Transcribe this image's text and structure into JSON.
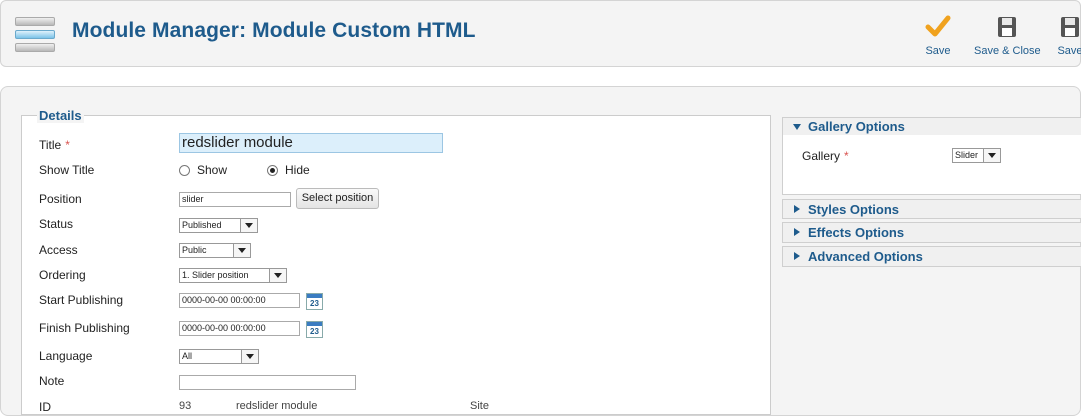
{
  "header": {
    "title": "Module Manager: Module Custom HTML",
    "logo_icon": "module-manager-icon",
    "buttons": [
      {
        "label": "Save",
        "icon": "checkmark-icon"
      },
      {
        "label": "Save & Close",
        "icon": "floppy-disk-icon"
      },
      {
        "label": "Save",
        "icon": "floppy-disk-icon"
      }
    ]
  },
  "details": {
    "legend": "Details",
    "title_label": "Title",
    "required_mark": "*",
    "title_value": "redslider module",
    "show_title_label": "Show Title",
    "show_title_options": [
      {
        "label": "Show",
        "selected": false
      },
      {
        "label": "Hide",
        "selected": true
      }
    ],
    "position_label": "Position",
    "position_value": "slider",
    "select_position_button": "Select position",
    "status_label": "Status",
    "status_value": "Published",
    "access_label": "Access",
    "access_value": "Public",
    "ordering_label": "Ordering",
    "ordering_value": "1. Slider position",
    "start_publishing_label": "Start Publishing",
    "start_publishing_value": "0000-00-00 00:00:00",
    "finish_publishing_label": "Finish Publishing",
    "finish_publishing_value": "0000-00-00 00:00:00",
    "calendar_day": "23",
    "language_label": "Language",
    "language_value": "All",
    "note_label": "Note",
    "note_value": "",
    "id_label": "ID",
    "id_value": "93",
    "id_title": "redslider module",
    "id_client": "Site"
  },
  "sidebar": {
    "gallery_options": {
      "heading": "Gallery Options",
      "expanded": true,
      "gallery_label": "Gallery",
      "required_mark": "*",
      "gallery_value": "Slider"
    },
    "styles_options": "Styles Options",
    "effects_options": "Effects Options",
    "advanced_options": "Advanced Options"
  },
  "colors": {
    "accent": "#1e5b8c",
    "required": "#d9534f",
    "title_input_bg": "#dceffb"
  }
}
